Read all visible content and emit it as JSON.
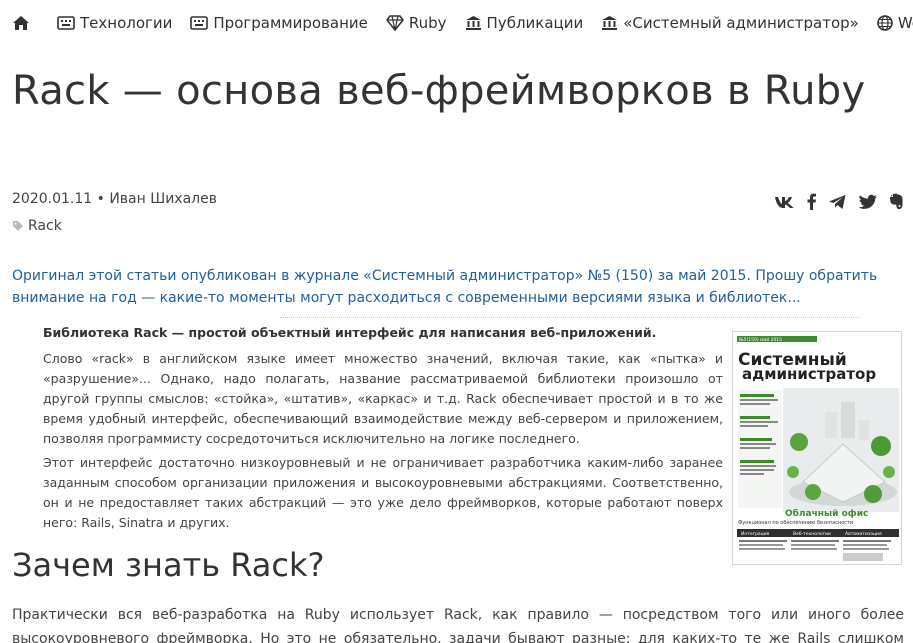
{
  "nav": {
    "items": [
      {
        "label": "Технологии",
        "icon": "keyboard-icon"
      },
      {
        "label": "Программирование",
        "icon": "keyboard-icon"
      },
      {
        "label": "Ruby",
        "icon": "diamond-icon"
      },
      {
        "label": "Публикации",
        "icon": "bank-icon"
      },
      {
        "label": "«Системный администратор»",
        "icon": "bank-icon"
      },
      {
        "label": "Web",
        "icon": "globe-icon"
      }
    ]
  },
  "article": {
    "title": "Rack — основа веб-фреймворков в Ruby",
    "date": "2020.01.11",
    "author": "Иван Шихалев",
    "meta": "2020.01.11 • Иван Шихалев",
    "tag": "Rack",
    "intro": "Оригинал этой статьи опубликован в журнале «Системный администратор» №5 (150) за май 2015. Прошу обратить внимание на год — какие-то моменты могут расходиться с современными версиями языка и библиотек...",
    "lead": "Библиотека Rack — простой объектный интерфейс для написания веб-приложений.",
    "abstract_1": "Слово «rack» в английском языке имеет множество значений, включая такие, как «пытка» и «разрушение»... Однако, надо полагать, название рассматриваемой библиотеки произошло от другой группы смыслов: «стойка», «штатив», «каркас» и т.д. Rack обеспечивает простой и в то же время удобный интерфейс, обеспечивающий взаимодействие между веб-сервером и приложением, позволяя программисту сосредоточиться исключительно на логике последнего.",
    "abstract_2": "Этот интерфейс достаточно низкоуровневый и не ограничивает разработчика каким-либо заранее заданным способом организации приложения и высокоуровневыми абстракциями. Соответственно, он и не предоставляет таких абстракций — это уже дело фреймворков, которые работают поверх него: Rails, Sinatra и других.",
    "section_heading": "Зачем знать Rack?",
    "section_text": "Практически вся веб-разработка на Ruby использует Rack, как правило — посредством того или иного более высокоуровневого фреймворка. Но это не обязательно, задачи бывают разные: для каких-то те же Rails слишком тяжеловесны, для каких-то"
  },
  "share": [
    "vk-icon",
    "facebook-icon",
    "telegram-icon",
    "twitter-icon",
    "evernote-icon"
  ],
  "cover": {
    "issue_line": "№5(150) май 2015",
    "title_top": "Системный",
    "title_bottom": "администратор",
    "headline": "Облачный офис",
    "subheadline": "Функционал по обеспечению безопасности",
    "col_1": "Интеграция",
    "col_2": "Веб-технологии",
    "col_3": "Автоматизация"
  },
  "colors": {
    "text": "#333333",
    "link": "#1f5f9e",
    "muted": "#444444",
    "accent_green": "#3f8a2c"
  }
}
